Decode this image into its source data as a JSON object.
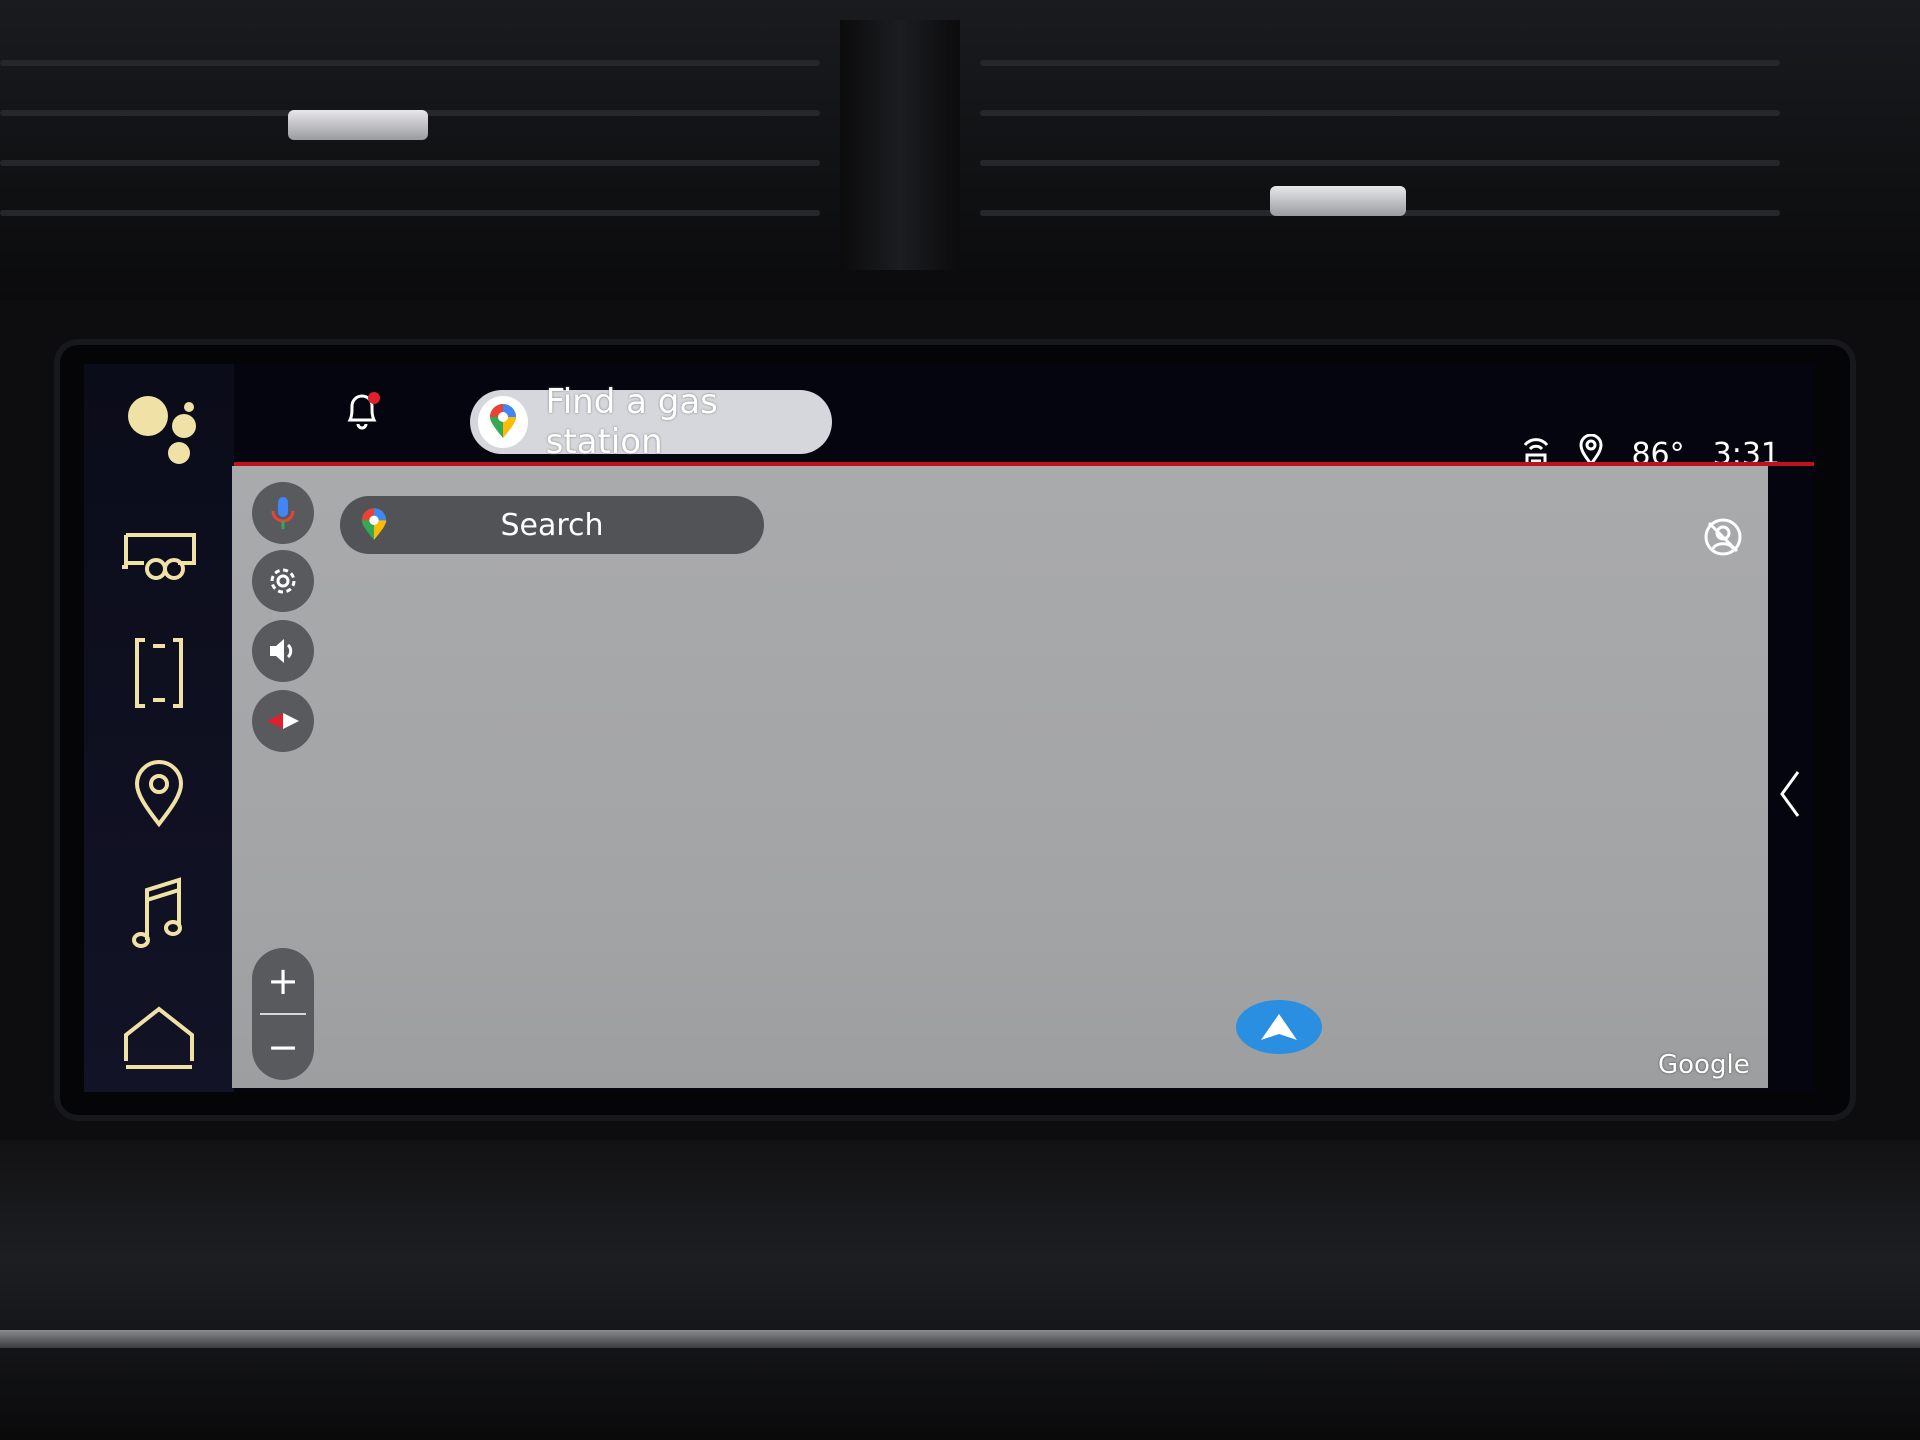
{
  "assistant_suggestion": {
    "text": "Find a gas station"
  },
  "status_bar": {
    "temperature": "86°",
    "time": "3:31"
  },
  "map": {
    "search_label": "Search",
    "attribution": "Google",
    "zoom_in_label": "+",
    "zoom_out_label": "−"
  },
  "rail_items": [
    {
      "icon": "trailer-icon"
    },
    {
      "icon": "phone-icon"
    },
    {
      "icon": "location-pin-icon"
    },
    {
      "icon": "music-note-icon"
    },
    {
      "icon": "home-icon"
    }
  ],
  "colors": {
    "accent_red": "#c0121e",
    "nav_blue": "#2a8fe0",
    "rail_icon": "#f0e2a6",
    "map_bg": "#a6a7a9"
  }
}
